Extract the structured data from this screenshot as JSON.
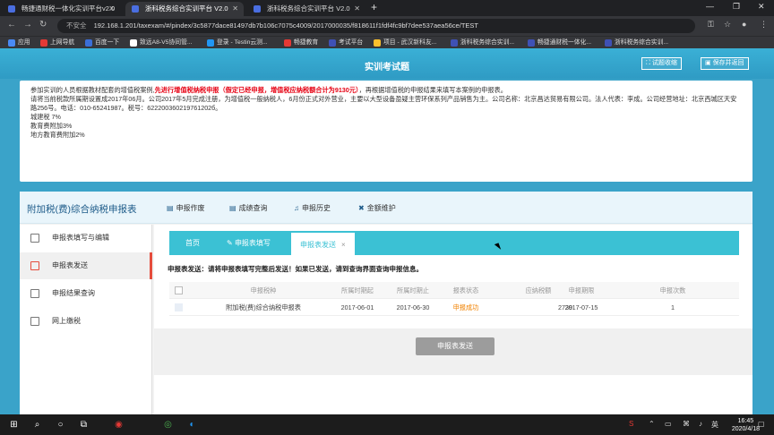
{
  "browser": {
    "tabs": [
      {
        "title": "畅捷通财税一体化实训平台v2.0"
      },
      {
        "title": "浙科税务综合实训平台 V2.0"
      },
      {
        "title": "浙科税务综合实训平台 V2.0"
      }
    ],
    "new_tab": "+",
    "address": {
      "insecure_label": "不安全",
      "url": "192.168.1.201/taxexam/#/pindex/3c5877dace81497db7b106c7075c4009/2017000035/f818611f1fdf4fc9bf7dee537aea56ce/TEST"
    },
    "bookmarks": [
      {
        "label": "应用",
        "color": "#4a8af4"
      },
      {
        "label": "上网导航",
        "color": "#e53935"
      },
      {
        "label": "百度一下",
        "color": "#3b6fd8"
      },
      {
        "label": "致远A8-V5协同管...",
        "color": "#ffffff"
      },
      {
        "label": "登录 - Testin云测...",
        "color": "#2196f3"
      },
      {
        "label": "畅捷教育",
        "color": "#e53935"
      },
      {
        "label": "考试平台",
        "color": "#3f51b5"
      },
      {
        "label": "项目 - 武汉新科友...",
        "color": "#fbc02d"
      },
      {
        "label": "浙科税务综合实训...",
        "color": "#3f51b5"
      },
      {
        "label": "畅捷通财税一体化...",
        "color": "#3f51b5"
      },
      {
        "label": "浙科税务综合实训...",
        "color": "#3f51b5"
      }
    ]
  },
  "app": {
    "title": "实训考试题",
    "btn_collapse": "试题收缩",
    "btn_save_return": "保存并返回"
  },
  "instruction": {
    "line1_pre": "参加实训的人员根据教材配套的增值税案例,",
    "line1_red": "先进行增值税纳税申报（假定已经申报，增值税应纳税额合计为9130元）",
    "line1_post": "，再根据增值税的申报结果来填写本案例的申报表。",
    "line2": "请将当前税款所属期设置成2017年06月。公司2017年5月完成注册，为增值税一般纳税人，6月份正式对外营业，主要以大型设备盈疑主营环保系列产品销售为主。公司名称：北京昌达贸易有限公司。法人代表：李成。公司经营地址：北京西城区天安路256号。电话：010-65241987。税号：622200360219761202б。",
    "line3": "城建税 7%",
    "line4": "教育费附加3%",
    "line5": "地方教育费附加2%"
  },
  "main": {
    "title": "附加税(费)综合纳税申报表",
    "nav": [
      {
        "label": "申报作废",
        "icon": "doc-icon"
      },
      {
        "label": "成绩查询",
        "icon": "doc-icon"
      },
      {
        "label": "申报历史",
        "icon": "bell-icon"
      },
      {
        "label": "金额维护",
        "icon": "tools-icon"
      }
    ],
    "sidebar": [
      {
        "label": "申报表填写与编辑"
      },
      {
        "label": "申报表发送"
      },
      {
        "label": "申报结果查询"
      },
      {
        "label": "网上缴税"
      }
    ],
    "tabs": [
      {
        "label": "首页"
      },
      {
        "label": "申报表填写"
      },
      {
        "label": "申报表发送",
        "close": "×"
      }
    ],
    "hint": "申报表发送：请将申报表填写完整后发送！如果已发送，请到查询界面查询申报信息。",
    "table": {
      "headers": [
        "申报税种",
        "所属时期起",
        "所属时期止",
        "报表状态",
        "应纳税额",
        "申报期限",
        "申报次数"
      ],
      "rows": [
        [
          "附加税(费)综合纳税申报表",
          "2017-06-01",
          "2017-06-30",
          "申报成功",
          "2739",
          "2017-07-15",
          "1"
        ]
      ]
    },
    "send_button": "申报表发送"
  },
  "taskbar": {
    "time": "16:45",
    "date": "2020/4/18"
  }
}
